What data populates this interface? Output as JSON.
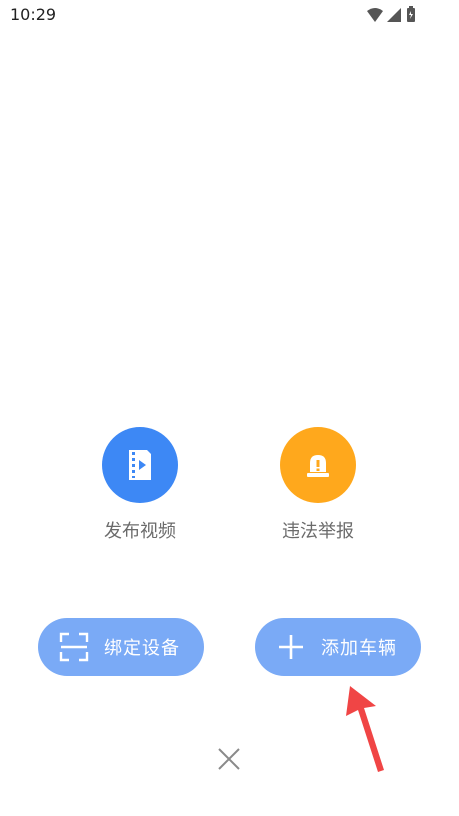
{
  "status_bar": {
    "time": "10:29",
    "icons": [
      "wifi-icon",
      "signal-icon",
      "battery-icon"
    ]
  },
  "actions": [
    {
      "label": "发布视频",
      "icon": "video-icon",
      "color": "#3d88f5"
    },
    {
      "label": "违法举报",
      "icon": "alarm-icon",
      "color": "#ffa81c"
    }
  ],
  "buttons": {
    "bind_device": {
      "label": "绑定设备",
      "icon": "scan-icon"
    },
    "add_vehicle": {
      "label": "添加车辆",
      "icon": "plus-icon"
    }
  },
  "close": {
    "icon": "close-icon"
  },
  "colors": {
    "button_bg": "#7aaaf6",
    "annotation_arrow": "#f04545"
  }
}
